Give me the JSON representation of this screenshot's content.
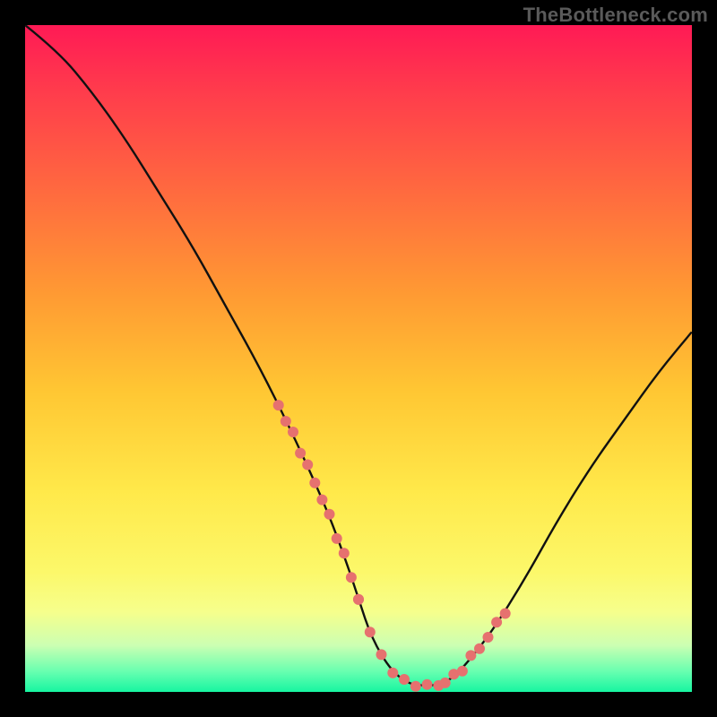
{
  "watermark": "TheBottleneck.com",
  "colors": {
    "frame_black": "#000000",
    "curve_black": "#111111",
    "accent_salmon": "#e6716f",
    "gradient_stops": [
      "#ff1a55",
      "#ff3c4c",
      "#ff6a3f",
      "#ff9933",
      "#ffc733",
      "#ffe94a",
      "#fcf86a",
      "#f6ff8c",
      "#ccffb2",
      "#66ffb0",
      "#17f5a1"
    ]
  },
  "dots_left": {
    "count": 12
  },
  "dots_right": {
    "count": 8
  },
  "dots_bottom": {
    "count": 8
  },
  "chart_data": {
    "type": "line",
    "title": "",
    "xlabel": "",
    "ylabel": "",
    "xlim": [
      0,
      100
    ],
    "ylim": [
      0,
      100
    ],
    "grid": false,
    "legend": false,
    "description": "Single V-shaped bottleneck curve over a red-to-green vertical gradient. The curve descends steeply from top-left, reaches a near-zero minimum around x≈55–60, then rises with a gentler slope toward the right edge. Salmon-colored dots cluster along the lower segments of both arms and along the floor near the minimum.",
    "series": [
      {
        "name": "bottleneck-curve",
        "x": [
          0,
          5,
          10,
          15,
          20,
          25,
          30,
          35,
          40,
          45,
          48,
          50,
          52,
          55,
          58,
          60,
          62,
          64,
          66,
          70,
          75,
          80,
          85,
          90,
          95,
          100
        ],
        "y": [
          100,
          96,
          90,
          83,
          75,
          67,
          58,
          49,
          39,
          28,
          20,
          14,
          8,
          3,
          1,
          1,
          1,
          2,
          4,
          9,
          17,
          26,
          34,
          41,
          48,
          54
        ]
      }
    ],
    "annotations": [
      {
        "name": "dots-left-arm",
        "approx_x_range": [
          38,
          50
        ],
        "approx_y_range": [
          6,
          27
        ],
        "color": "#e6716f"
      },
      {
        "name": "dots-floor",
        "approx_x_range": [
          50,
          62
        ],
        "approx_y_range": [
          0,
          3
        ],
        "color": "#e6716f"
      },
      {
        "name": "dots-right-arm",
        "approx_x_range": [
          63,
          72
        ],
        "approx_y_range": [
          3,
          15
        ],
        "color": "#e6716f"
      }
    ]
  }
}
